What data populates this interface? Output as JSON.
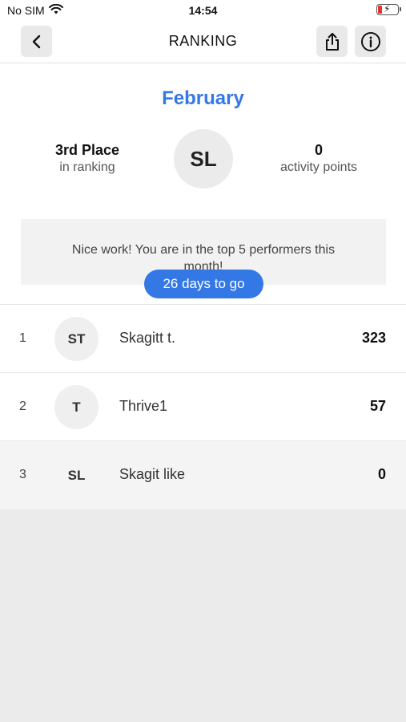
{
  "status_bar": {
    "carrier": "No SIM",
    "time": "14:54",
    "icons": [
      "wifi-icon",
      "battery-charging-icon"
    ],
    "battery_color": "#e5322d"
  },
  "nav": {
    "title": "RANKING",
    "left_icon": "back-chevron-icon",
    "right_icons": [
      "share-icon",
      "info-icon"
    ]
  },
  "summary": {
    "month": "February",
    "place": "3rd Place",
    "place_sub": "in ranking",
    "avatar_initials": "SL",
    "points": "0",
    "points_sub": "activity points",
    "days_pill": "26 days to go",
    "message": "Nice work! You are in the top 5 performers this month!"
  },
  "ranking": [
    {
      "rank": "1",
      "initials": "ST",
      "name": "Skagitt t.",
      "points": "323",
      "current": false
    },
    {
      "rank": "2",
      "initials": "T",
      "name": "Thrive1",
      "points": "57",
      "current": false
    },
    {
      "rank": "3",
      "initials": "SL",
      "name": "Skagit like",
      "points": "0",
      "current": true
    }
  ],
  "colors": {
    "accent": "#3478e5",
    "background": "#ebebeb"
  }
}
